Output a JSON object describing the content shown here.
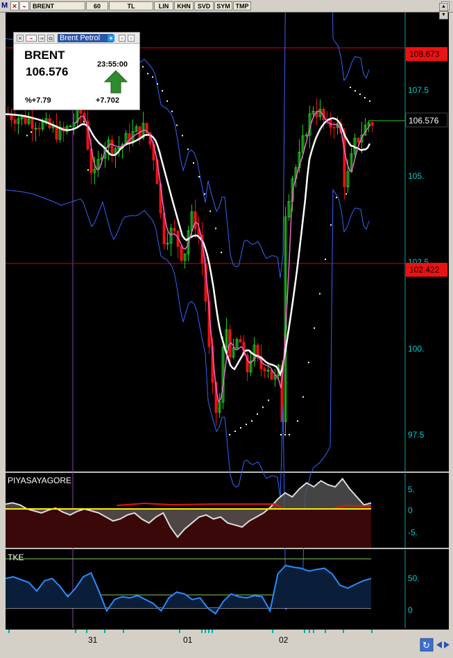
{
  "toolbar": {
    "logo": "M",
    "symbol": "BRENT",
    "period": "60",
    "currency": "TL",
    "buttons": [
      "LIN",
      "KHN",
      "SVD",
      "SYM",
      "TMP"
    ]
  },
  "widget": {
    "title": "Brent Petrol",
    "symbol": "BRENT",
    "price": "106.576",
    "time": "23:55:00",
    "percent_change": "%+7.79",
    "change": "+7.702",
    "trend": "up-arrow-icon"
  },
  "price_axis": {
    "labels": [
      "107.5",
      "105.",
      "102.5",
      "100.",
      "97.5"
    ],
    "current_price": "106.576",
    "level_high": "108.673",
    "level_low": "102.422"
  },
  "panel_piyasa": {
    "title": "PIYASAYAGORE",
    "labels": [
      "5.",
      "0",
      "-5."
    ]
  },
  "panel_tke": {
    "title": "TKE",
    "labels": [
      "50.",
      "0"
    ]
  },
  "time_axis": {
    "labels": [
      "31",
      "01",
      "02"
    ]
  },
  "colors": {
    "background": "#000000",
    "bull": "#22cc22",
    "bear": "#ee1111",
    "level_line": "#dd0000",
    "axis_text": "#00cccc",
    "bands": "#3366ff"
  }
}
